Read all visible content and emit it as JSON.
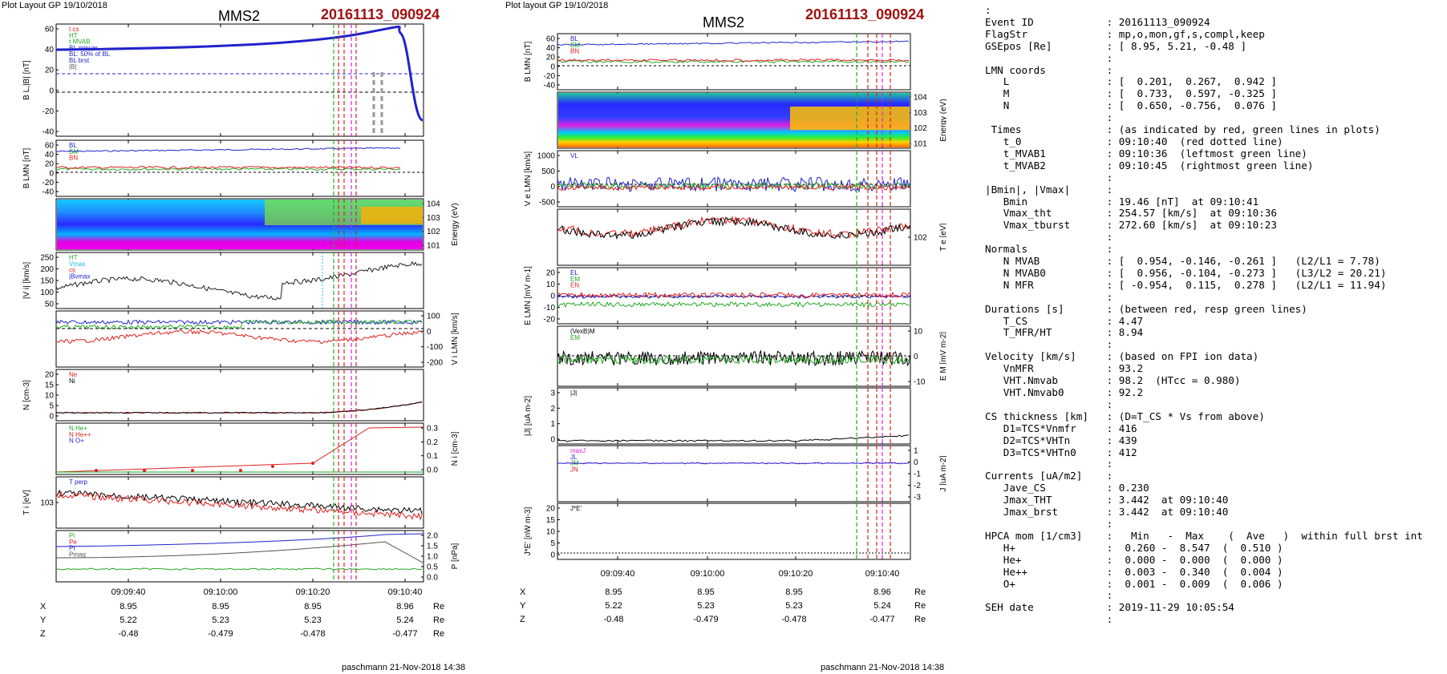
{
  "left_header": {
    "layout": "Plot Layout GP 19/10/2018",
    "spacecraft": "MMS2",
    "event": "20161113_090924"
  },
  "mid_header": {
    "layout": "Plot layout GP 19/10/2018",
    "spacecraft": "MMS2",
    "event": "20161113_090924"
  },
  "left_footer": "paschmann 21-Nov-2018 14:38",
  "mid_footer": "paschmann 21-Nov-2018 14:38",
  "ephem": {
    "times": [
      "09:09:40",
      "09:10:00",
      "09:10:20",
      "09:10:40"
    ],
    "rows": [
      {
        "label": "X",
        "values": [
          "8.95",
          "8.95",
          "8.95",
          "8.96"
        ],
        "unit": "Re"
      },
      {
        "label": "Y",
        "values": [
          "5.22",
          "5.23",
          "5.23",
          "5.24"
        ],
        "unit": "Re"
      },
      {
        "label": "Z",
        "values": [
          "-0.48",
          "-0.479",
          "-0.478",
          "-0.477"
        ],
        "unit": "Re"
      }
    ]
  },
  "colors": {
    "B": "#2222cc",
    "red": "#e02020",
    "green": "#22aa22",
    "black": "#000000",
    "magenta": "#e010e0",
    "cyan": "#20b8e0"
  },
  "chart_data": [
    {
      "panel": "L1",
      "type": "line",
      "ylabel": "B_L,|B| [nT]",
      "ylim": [
        -50,
        68
      ],
      "yticks": [
        "60",
        "40",
        "20",
        "0",
        "-20",
        "-40"
      ],
      "legend": [
        "t_cs",
        "HT",
        "t_MVAB",
        "BL minvar",
        "BL: 50% of BL",
        "BL brst",
        "|B|"
      ],
      "series": [
        {
          "name": "BL brst",
          "values": "blue profile rising 42 to 64 then dropping to -35"
        }
      ]
    },
    {
      "panel": "L2",
      "type": "line",
      "ylabel": "B_LMN [nT]",
      "ylim": [
        -50,
        65
      ],
      "yticks": [
        "60",
        "40",
        "20",
        "0",
        "-20",
        "-40"
      ],
      "legend": [
        "BL",
        "BM",
        "BN"
      ]
    },
    {
      "panel": "L3",
      "type": "heatmap",
      "ylabel": "Energy (eV)",
      "yticks": [
        "10^4",
        "10^3",
        "10^2",
        "10^1"
      ]
    },
    {
      "panel": "L4",
      "type": "line",
      "ylabel": "|V_i| [km/s]",
      "yticks": [
        "250",
        "200",
        "150",
        "100",
        "50"
      ],
      "legend": [
        "HT",
        "Vmax",
        "cs",
        "|Bvmax"
      ]
    },
    {
      "panel": "L5",
      "type": "line",
      "ylabel": "V_i LMN [km/s]",
      "yticks": [
        "100",
        "0",
        "-100",
        "-200"
      ]
    },
    {
      "panel": "L6",
      "type": "line",
      "ylabel": "N [cm^-3]",
      "yticks": [
        "20",
        "15",
        "10",
        "5",
        "0"
      ],
      "legend": [
        "Ne",
        "Ni"
      ]
    },
    {
      "panel": "L7",
      "type": "line",
      "ylabel": "N_i [cm^-3]",
      "yticks": [
        "0.3",
        "0.2",
        "0.1",
        "0.0"
      ],
      "legend": [
        "N  He+",
        "N  He++",
        "N  O+"
      ]
    },
    {
      "panel": "L8",
      "type": "line",
      "ylabel": "T_i [eV]",
      "yticks": [
        "10^3"
      ],
      "legend": [
        "T_perp"
      ]
    },
    {
      "panel": "L9",
      "type": "line",
      "ylabel": "P [nPa]",
      "yticks": [
        "2.0",
        "1.5",
        "1.0",
        "0.5",
        "0.0"
      ],
      "legend": [
        "Pi",
        "Pe",
        "Pt",
        "Pmag"
      ]
    },
    {
      "panel": "M1",
      "type": "line",
      "ylabel": "B_LMN [nT]",
      "yticks": [
        "60",
        "40",
        "20",
        "0",
        "-20",
        "-40"
      ],
      "legend": [
        "BL",
        "BM",
        "BN"
      ]
    },
    {
      "panel": "M2",
      "type": "heatmap",
      "ylabel": "Energy (eV)",
      "yticks": [
        "10^4",
        "10^3",
        "10^2",
        "10^1"
      ]
    },
    {
      "panel": "M3",
      "type": "line",
      "ylabel": "V_e LMN [km/s]",
      "yticks": [
        "1000",
        "500",
        "0",
        "-500"
      ],
      "legend": [
        "VL"
      ]
    },
    {
      "panel": "M4",
      "type": "line",
      "ylabel": "T_e [eV]",
      "yticks": [
        "10^2"
      ]
    },
    {
      "panel": "M5",
      "type": "line",
      "ylabel": "E_LMN [mV m^-1]",
      "yticks": [
        "20",
        "10",
        "0",
        "-10",
        "-20"
      ],
      "legend": [
        "EL",
        "EM",
        "EN"
      ]
    },
    {
      "panel": "M6",
      "type": "line",
      "ylabel": "E_M [mV m^-2]",
      "yticks": [
        "10",
        "0",
        "-10"
      ],
      "legend": [
        "(VexB)M",
        "EM"
      ]
    },
    {
      "panel": "M7",
      "type": "line",
      "ylabel": "|J| [uA m^-2]",
      "yticks": [
        "3",
        "2",
        "1",
        "0"
      ],
      "legend": [
        "|J|"
      ]
    },
    {
      "panel": "M8",
      "type": "line",
      "ylabel": "J [uA m^-2]",
      "yticks": [
        "1",
        "0",
        "-1",
        "-2",
        "-3"
      ],
      "legend": [
        "maxJ",
        "JL",
        "JM",
        "JN"
      ]
    },
    {
      "panel": "M9",
      "type": "line",
      "ylabel": "J*E' [nW m^-3]",
      "yticks": [
        "20",
        "15",
        "10",
        "5",
        "0"
      ],
      "legend": [
        "J*E'"
      ]
    }
  ],
  "info": [
    [
      ":",
      ""
    ],
    [
      "Event ID",
      ": 20161113_090924"
    ],
    [
      "FlagStr",
      ": mp,o,mon,gf,s,compl,keep"
    ],
    [
      "GSEpos [Re]",
      ": [ 8.95, 5.21, -0.48 ]"
    ],
    [
      "",
      ":"
    ],
    [
      "LMN coords",
      ":"
    ],
    [
      "   L",
      ": [  0.201,  0.267,  0.942 ]"
    ],
    [
      "   M",
      ": [  0.733,  0.597, -0.325 ]"
    ],
    [
      "   N",
      ": [  0.650, -0.756,  0.076 ]"
    ],
    [
      "",
      ":"
    ],
    [
      " Times",
      ": (as indicated by red, green lines in plots)"
    ],
    [
      "   t_0",
      ": 09:10:40  (red dotted line)"
    ],
    [
      "   t_MVAB1",
      ": 09:10:36  (leftmost green line)"
    ],
    [
      "   t_MVAB2",
      ": 09:10:45  (rightmost green line)"
    ],
    [
      "",
      ":"
    ],
    [
      "|Bmin|, |Vmax|",
      ":"
    ],
    [
      "   Bmin",
      ": 19.46 [nT]  at 09:10:41"
    ],
    [
      "   Vmax_tht",
      ": 254.57 [km/s]  at 09:10:36"
    ],
    [
      "   Vmax_tburst",
      ": 272.60 [km/s]  at 09:10:23"
    ],
    [
      "",
      ":"
    ],
    [
      "Normals",
      ":"
    ],
    [
      "   N MVAB",
      ": [  0.954, -0.146, -0.261 ]   (L2/L1 = 7.78)"
    ],
    [
      "   N MVAB0",
      ": [  0.956, -0.104, -0.273 ]   (L3/L2 = 20.21)"
    ],
    [
      "   N MFR",
      ": [ -0.954,  0.115,  0.278 ]   (L2/L1 = 11.94)"
    ],
    [
      "",
      ":"
    ],
    [
      "Durations [s]",
      ": (between red, resp green lines)"
    ],
    [
      "   T_CS",
      ": 4.47"
    ],
    [
      "   T_MFR/HT",
      ": 8.94"
    ],
    [
      "",
      ":"
    ],
    [
      "Velocity [km/s]",
      ": (based on FPI ion data)"
    ],
    [
      "   VnMFR",
      ": 93.2"
    ],
    [
      "   VHT.Nmvab",
      ": 98.2  (HTcc = 0.980)"
    ],
    [
      "   VHT.Nmvab0",
      ": 92.2"
    ],
    [
      "",
      ":"
    ],
    [
      "CS thickness [km]",
      ": (D=T_CS * Vs from above)"
    ],
    [
      "   D1=TCS*Vnmfr",
      ": 416"
    ],
    [
      "   D2=TCS*VHTn",
      ": 439"
    ],
    [
      "   D3=TCS*VHTn0",
      ": 412"
    ],
    [
      "",
      ":"
    ],
    [
      "Currents [uA/m2]",
      ":"
    ],
    [
      "   Jave_CS",
      ": 0.230"
    ],
    [
      "   Jmax_THT",
      ": 3.442  at 09:10:40"
    ],
    [
      "   Jmax_brst",
      ": 3.442  at 09:10:40"
    ],
    [
      "",
      ":"
    ],
    [
      "HPCA mom [1/cm3]",
      ":   Min   -  Max    (  Ave   )  within full brst int"
    ],
    [
      "   H+",
      ":  0.260 -  8.547  (  0.510 )"
    ],
    [
      "   He+",
      ":  0.000 -  0.000  (  0.000 )"
    ],
    [
      "   He++",
      ":  0.003 -  0.340  (  0.004 )"
    ],
    [
      "   O+",
      ":  0.001 -  0.009  (  0.006 )"
    ],
    [
      "",
      ":"
    ],
    [
      "SEH date",
      ": 2019-11-29 10:05:54"
    ],
    [
      "",
      ":"
    ]
  ]
}
